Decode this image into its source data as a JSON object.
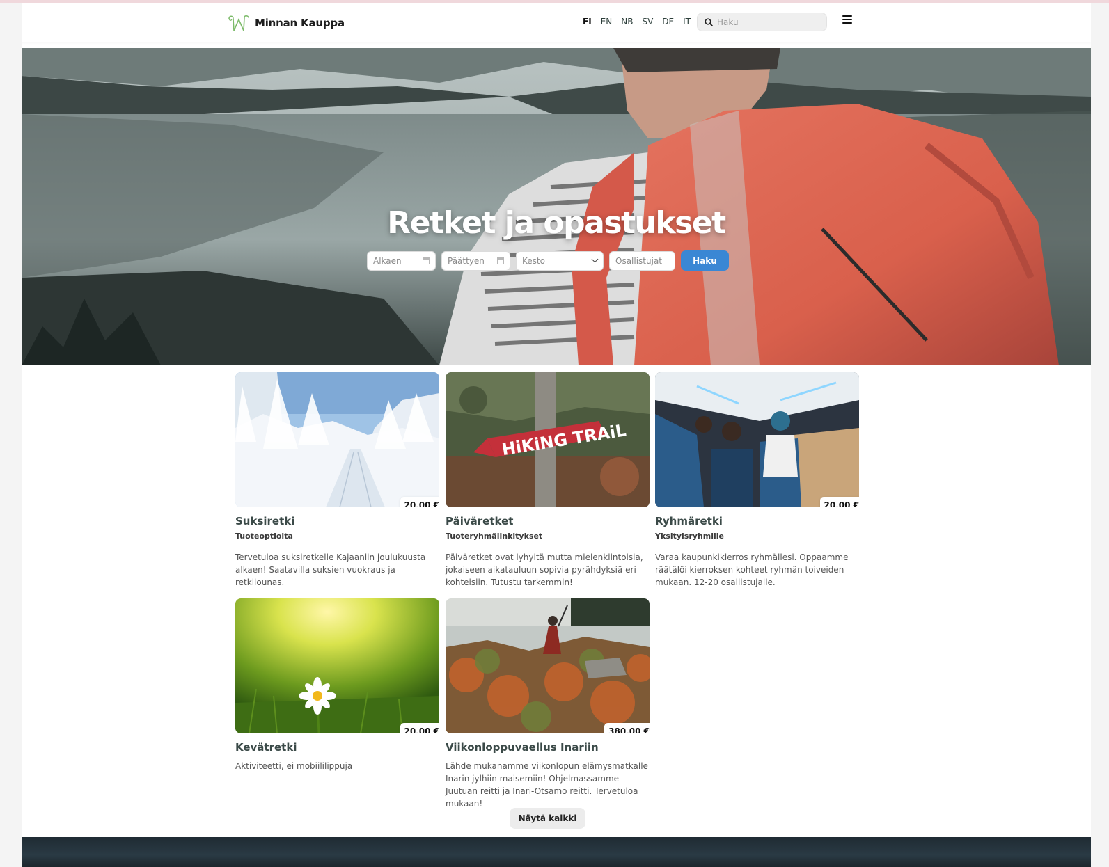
{
  "header": {
    "logo_text": "Minnan Kauppa",
    "languages": [
      "FI",
      "EN",
      "NB",
      "SV",
      "DE",
      "IT"
    ],
    "active_language": "FI",
    "search_placeholder": "Haku"
  },
  "hero": {
    "title": "Retket ja opastukset",
    "start_placeholder": "Alkaen",
    "end_placeholder": "Päättyen",
    "duration_select": "Kesto",
    "participants_placeholder": "Osallistujat",
    "search_button": "Haku"
  },
  "products": [
    {
      "title": "Suksiretki",
      "subtitle": "Tuoteoptioita",
      "description": "Tervetuloa suksiretkelle Kajaaniin joulukuusta alkaen! Saatavilla suksien vuokraus ja retkilounas.",
      "price": "20,00 €"
    },
    {
      "title": "Päiväretket",
      "subtitle": "Tuoteryhmälinkitykset",
      "description": "Päiväretket ovat lyhyitä mutta mielenkiintoisia, jokaiseen aikatauluun sopivia pyrähdyksiä eri kohteisiin. Tutustu tarkemmin!",
      "price": ""
    },
    {
      "title": "Ryhmäretki",
      "subtitle": "Yksityisryhmille",
      "description": "Varaa kaupunkikierros ryhmällesi. Oppaamme räätälöi kierroksen kohteet ryhmän toiveiden mukaan. 12-20 osallistujalle.",
      "price": "20,00 €"
    },
    {
      "title": "Kevätretki",
      "subtitle": "",
      "description": "Aktiviteetti, ei mobiililippuja",
      "price": "20,00 €"
    },
    {
      "title": "Viikonloppuvaellus Inariin",
      "subtitle": "",
      "description": "Lähde mukanamme viikonlopun elämysmatkalle Inarin jylhiin maisemiin! Ohjelmassamme Juutuan reitti ja Inari-Otsamo reitti. Tervetuloa mukaan!",
      "price": "380,00 €"
    }
  ],
  "show_all_button": "Näytä kaikki",
  "sign_text": "HiKiNG TRAiL",
  "colors": {
    "accent": "#3a87d4",
    "logo_green": "#7dbb6a"
  }
}
